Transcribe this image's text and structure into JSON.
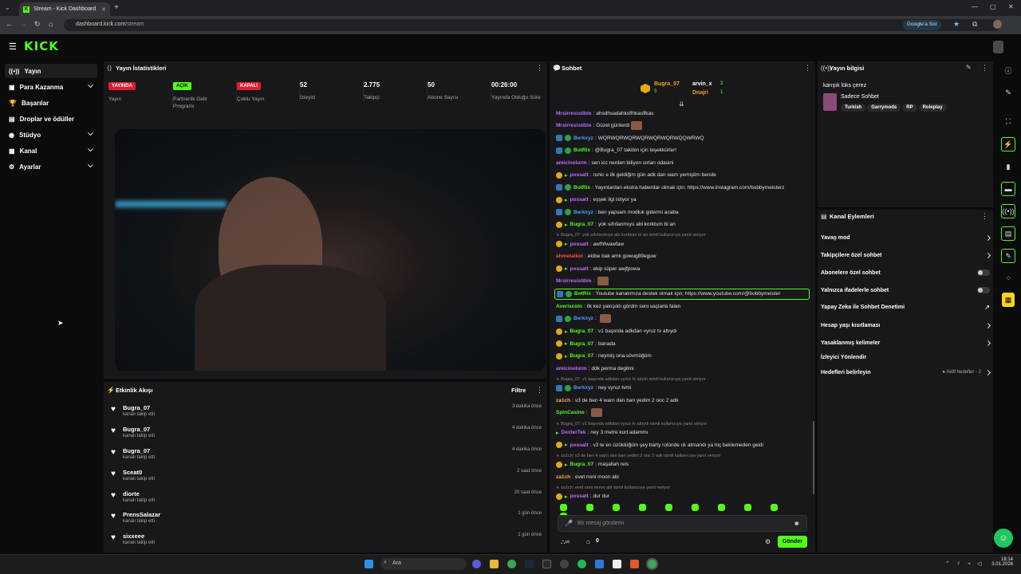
{
  "browser": {
    "tab_title": "Stream - Kick Dashboard",
    "url_domain": "dashboard.kick.com",
    "url_path": "/stream",
    "google_btn": "Google'a Sor"
  },
  "brand": {
    "logo": "KICK",
    "accent": "#53fc18"
  },
  "sidebar": {
    "items": [
      {
        "label": "Yayın"
      },
      {
        "label": "Para Kazanma"
      },
      {
        "label": "Başarılar"
      },
      {
        "label": "Droplar ve ödüller"
      },
      {
        "label": "Stüdyo"
      },
      {
        "label": "Kanal"
      },
      {
        "label": "Ayarlar"
      }
    ]
  },
  "stats": {
    "title": "Yayın İstatistikleri",
    "items": [
      {
        "badge": "YAYINDA",
        "label": "Yayın"
      },
      {
        "badge": "AÇIK",
        "label": "Partnerlik Gelir Programı"
      },
      {
        "badge": "KAPALI",
        "label": "Çoklu Yayın"
      },
      {
        "value": "52",
        "label": "İzleyici"
      },
      {
        "value": "2.775",
        "label": "Takipçi"
      },
      {
        "value": "50",
        "label": "Abone Sayısı"
      },
      {
        "value": "00:26:00",
        "label": "Yayında Olduğu Süre"
      }
    ]
  },
  "activity": {
    "title": "Etkinlik Akışı",
    "filter": "Filtre",
    "items": [
      {
        "name": "Bugra_07",
        "sub": "kanalı takip etti",
        "time": "3 dakika önce"
      },
      {
        "name": "Bugra_07",
        "sub": "kanalı takip etti",
        "time": "4 dakika önce"
      },
      {
        "name": "Bugra_07",
        "sub": "kanalı takip etti",
        "time": "4 dakika önce"
      },
      {
        "name": "Sceat0",
        "sub": "kanalı takip etti",
        "time": "2 saat önce"
      },
      {
        "name": "diorte",
        "sub": "kanalı takip etti",
        "time": "20 saat önce"
      },
      {
        "name": "PrensSalazar",
        "sub": "kanalı takip etti",
        "time": "1 gün önce"
      },
      {
        "name": "sixxeee",
        "sub": "kanalı takip etti",
        "time": "1 gün önce"
      }
    ]
  },
  "chat": {
    "title": "Sohbet",
    "pinned": [
      {
        "name": "Bugra_07",
        "count": "5"
      },
      {
        "name": "arvin_x",
        "count": "3"
      },
      {
        "name": "Dnajri",
        "count": "1"
      }
    ],
    "messages": [
      {
        "user": "Mrsirresistible",
        "color": "#b86bff",
        "text": "ahsdhsadahksflhkasflkas"
      },
      {
        "user": "Mrsirresistible",
        "color": "#b86bff",
        "text": "Güzel günlerdi"
      },
      {
        "user": "Berkxyz",
        "color": "#4a9eff",
        "text": "WQRWQRWQRWQRWQRWQRWQQWRWQ"
      },
      {
        "user": "BotRix",
        "color": "#53fc18",
        "text": "@Bugra_07 takibin için teşekkürler!"
      },
      {
        "user": "amicinolurm",
        "color": "#c86bff",
        "text": "sen icc nerden biliyon sırları odasini"
      },
      {
        "user": "possatt",
        "color": "#c86bff",
        "text": "runic e ilk geldiğim gün adk dan warn yemiştim bende"
      },
      {
        "user": "BotRix",
        "color": "#53fc18",
        "text": "Yayınlardan ekstra haberdar olmak için; https://www.instagram.com/bobbymeisterz"
      },
      {
        "user": "possatt",
        "color": "#c86bff",
        "text": "eşşek ilgi istiyor ya"
      },
      {
        "user": "Berkxyz",
        "color": "#4a9eff",
        "text": "ben yapsam modluk gidermi acaba"
      },
      {
        "user": "Bugra_07",
        "color": "#53fc18",
        "text": "yok sıfırlanmıyo abi korktum bi an"
      },
      {
        "reply": "Bugra_07: yok sıfırlanmıyo abi korktum bi an isimli kullanıcıya yanıt veriyor"
      },
      {
        "user": "possatt",
        "color": "#c86bff",
        "text": "awfhfwawfaw"
      },
      {
        "user": "ahmetalkın",
        "color": "#ff4a4a",
        "text": "ekibe bak amk gowug89eguw"
      },
      {
        "user": "possatt",
        "color": "#c86bff",
        "text": "ekip süper awjfpowa"
      },
      {
        "user": "Mrsirresistible",
        "color": "#b86bff",
        "text": ""
      },
      {
        "user": "BotRix",
        "color": "#53fc18",
        "text": "Youtube kanalımıza destek olmak için; https://www.youtube.com/@bobbymeister"
      },
      {
        "user": "Averiscoin",
        "color": "#53fc18",
        "text": "ilk kez yakışıklı gördm seni saçlarla falan"
      },
      {
        "user": "Berkxyz",
        "color": "#4a9eff",
        "text": ""
      },
      {
        "user": "Bugra_07",
        "color": "#53fc18",
        "text": "v1 başında adkdan vyruz tv attıydı"
      },
      {
        "user": "Bugra_07",
        "color": "#53fc18",
        "text": "banada"
      },
      {
        "user": "Bugra_07",
        "color": "#53fc18",
        "text": "neymiş ona sövmüğüm"
      },
      {
        "user": "amicinolurm",
        "color": "#c86bff",
        "text": "ddk perma degilmi"
      },
      {
        "reply": "Bugra_07: v1 başında adkdan vyruz tv atıydı isimli kullanıcıya yanıt veriyor"
      },
      {
        "user": "Berkxyz",
        "color": "#4a9eff",
        "text": "ney vyruz tvmi"
      },
      {
        "user": "za1ch",
        "color": "#ffb347",
        "text": "v3 de ben 4 warn dan ban yedim 2 ooc 2 adk"
      },
      {
        "user": "SpinCasino",
        "color": "#53fc18",
        "text": ""
      },
      {
        "reply": "Bugra_07: v1 başında adkdan vyruz tv attıydı isimli kullanıcıya yanıt veriyor"
      },
      {
        "user": "DexterTek",
        "color": "#b86bff",
        "text": "ney 3 metre kurt adammı"
      },
      {
        "user": "possatt",
        "color": "#c86bff",
        "text": "v3 te en üzüldüğüm şey barty rolünde ck atmandı ya hiç beklemeden geldi"
      },
      {
        "reply": "za1ch: v3 de ben 4 warn dan ban yedim 2 ooc 2 adk isimli kullanıcıya yanıt veriyor"
      },
      {
        "user": "Bugra_07",
        "color": "#53fc18",
        "text": "maşallah reis"
      },
      {
        "user": "za1ch",
        "color": "#ffb347",
        "text": "evet noni moon abi"
      },
      {
        "reply": "za1ch: evet noni moon abi isimli kullanıcıya yanıt veriyor"
      },
      {
        "user": "possatt",
        "color": "#c86bff",
        "text": "dur dur"
      }
    ],
    "input_placeholder": "Bir mesaj gönderin",
    "viewer_count": "0",
    "send_label": "Gönder"
  },
  "stream_info": {
    "title": "Yayın bilgisi",
    "stream_title": "karışık lüks çerez",
    "category": "Sadece Sohbet",
    "tags": [
      "Turkish",
      "Garrymods",
      "RP",
      "Roleplay"
    ]
  },
  "channel_actions": {
    "title": "Kanal Eylemleri",
    "items": [
      {
        "label": "Yavaş mod",
        "control": "arrow"
      },
      {
        "label": "Takipçilere özel sohbet",
        "control": "arrow"
      },
      {
        "label": "Abonelere özel sohbet",
        "control": "toggle"
      },
      {
        "label": "Yalnızca ifadelerle sohbet",
        "control": "toggle"
      },
      {
        "label": "Yapay Zeka ile Sohbet Denetimi",
        "control": "external"
      },
      {
        "label": "Hesap yaşı kısıtlaması",
        "control": "arrow"
      },
      {
        "label": "Yasaklanmış kelimeler",
        "control": "arrow"
      },
      {
        "label": "İzleyici Yönlendir",
        "control": "none"
      },
      {
        "label": "Hedefleri belirleyin",
        "control": "arrow",
        "extra": "Aktif hedefler - 2"
      }
    ]
  },
  "taskbar": {
    "search": "Ara",
    "time": "18:14",
    "date": "3.01.2026"
  }
}
